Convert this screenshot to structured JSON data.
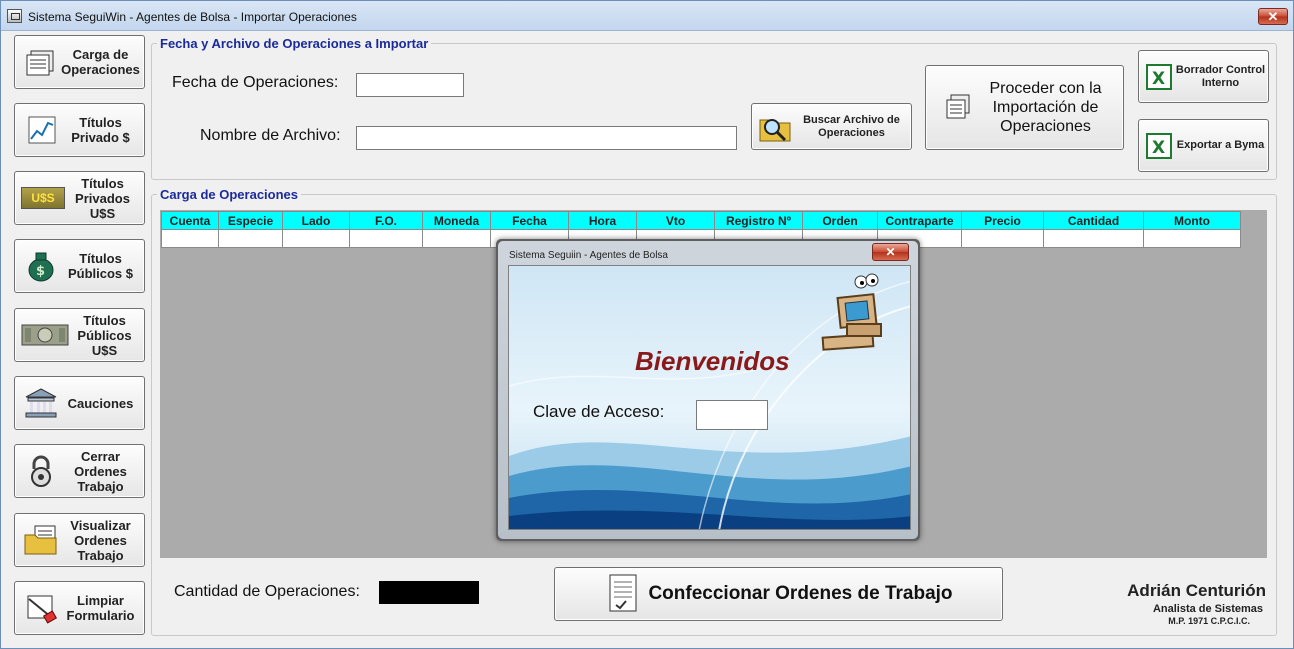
{
  "window": {
    "title": "Sistema SeguiWin - Agentes de Bolsa - Importar Operaciones",
    "close_label": "✕"
  },
  "sidebar": {
    "items": [
      {
        "label": "Carga de Operaciones"
      },
      {
        "label": "Títulos Privado $"
      },
      {
        "label": "Títulos Privados U$S",
        "icon_text": "U$S"
      },
      {
        "label": "Títulos Públicos $"
      },
      {
        "label": "Títulos Públicos U$S"
      },
      {
        "label": "Cauciones"
      },
      {
        "label": "Cerrar Ordenes Trabajo"
      },
      {
        "label": "Visualizar Ordenes Trabajo"
      },
      {
        "label": "Limpiar Formulario"
      }
    ]
  },
  "import_group": {
    "title": "Fecha y Archivo de Operaciones a Importar",
    "fecha_label": "Fecha de Operaciones:",
    "fecha_value": "",
    "archivo_label": "Nombre de Archivo:",
    "archivo_value": "",
    "buscar_label": "Buscar Archivo de Operaciones",
    "proceder_label": "Proceder con la Importación de Operaciones",
    "borrador_label": "Borrador Control Interno",
    "exportar_label": "Exportar a Byma"
  },
  "carga_group": {
    "title": "Carga de Operaciones",
    "columns": [
      "Cuenta",
      "Especie",
      "Lado",
      "F.O.",
      "Moneda",
      "Fecha",
      "Hora",
      "Vto",
      "Registro Nº",
      "Orden",
      "Contraparte",
      "Precio",
      "Cantidad",
      "Monto"
    ]
  },
  "dialog": {
    "title": "Sistema Seguiin - Agentes de Bolsa",
    "close_label": "✕",
    "welcome": "Bienvenidos",
    "clave_label": "Clave de Acceso:",
    "clave_value": ""
  },
  "footer": {
    "cantidad_label": "Cantidad de Operaciones:",
    "cantidad_value": "",
    "confeccionar_label": "Confeccionar Ordenes de Trabajo",
    "author_name": "Adrián Centurión",
    "author_role": "Analista de Sistemas",
    "author_reg": "M.P. 1971 C.P.C.I.C."
  },
  "colors": {
    "grid_header": "#00ffff",
    "group_title": "#1b2a9b",
    "welcome": "#8a1a1a",
    "excel": "#1d7a2e"
  }
}
